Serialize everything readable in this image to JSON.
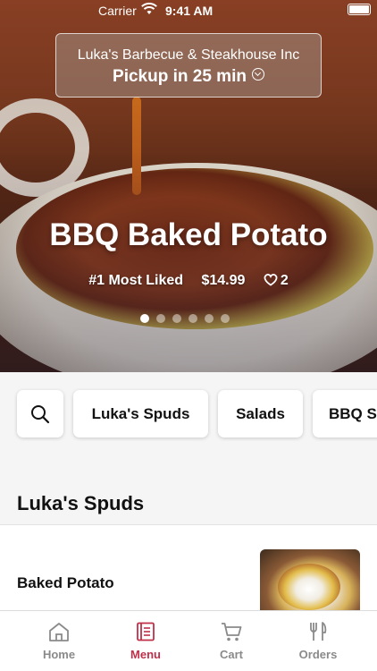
{
  "status_bar": {
    "carrier": "Carrier",
    "time": "9:41 AM"
  },
  "store": {
    "name": "Luka's Barbecue & Steakhouse Inc",
    "pickup": "Pickup in 25 min"
  },
  "featured": {
    "title": "BBQ Baked Potato",
    "rank": "#1 Most Liked",
    "price": "$14.99",
    "likes": "2",
    "carousel_pages": 6,
    "carousel_active": 0
  },
  "categories": [
    "Luka's Spuds",
    "Salads",
    "BBQ S"
  ],
  "section": {
    "title": "Luka's Spuds"
  },
  "items": [
    {
      "name": "Baked Potato"
    }
  ],
  "tabs": [
    {
      "label": "Home",
      "icon": "home-icon",
      "active": false
    },
    {
      "label": "Menu",
      "icon": "menu-icon",
      "active": true
    },
    {
      "label": "Cart",
      "icon": "cart-icon",
      "active": false
    },
    {
      "label": "Orders",
      "icon": "fork-knife-icon",
      "active": false
    }
  ],
  "colors": {
    "accent": "#c0304a",
    "inactive": "#8a8a8a"
  }
}
